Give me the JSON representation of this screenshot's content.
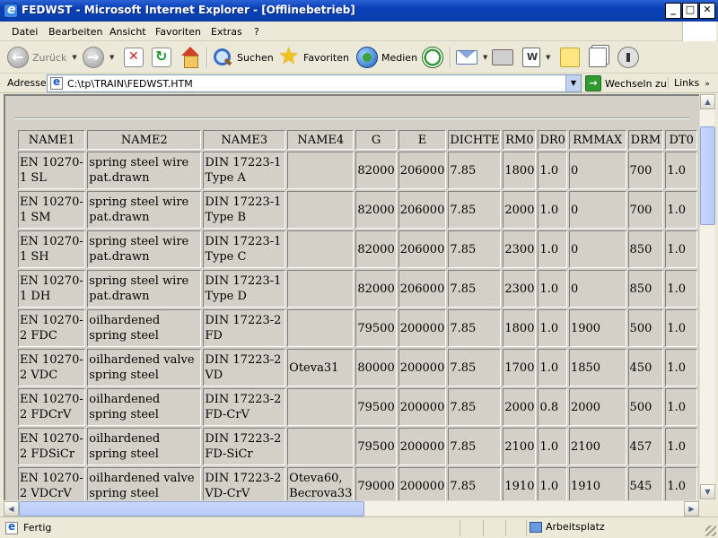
{
  "window": {
    "title": "FEDWST - Microsoft Internet Explorer - [Offlinebetrieb]"
  },
  "menu": [
    "Datei",
    "Bearbeiten",
    "Ansicht",
    "Favoriten",
    "Extras",
    "?"
  ],
  "toolbar": {
    "back_label": "Zurück",
    "search_label": "Suchen",
    "favorites_label": "Favoriten",
    "media_label": "Medien"
  },
  "address": {
    "label": "Adresse",
    "value": "C:\\tp\\TRAIN\\FEDWST.HTM",
    "go_label": "Wechseln zu",
    "links_label": "Links"
  },
  "table": {
    "headers": [
      "NAME1",
      "NAME2",
      "NAME3",
      "NAME4",
      "G",
      "E",
      "DICHTE",
      "RM0",
      "DR0",
      "RMMAX",
      "DRM",
      "DT0"
    ],
    "rows": [
      [
        "EN 10270-1 SL",
        "spring steel wire pat.drawn",
        "DIN 17223-1 Type A",
        "",
        "82000",
        "206000",
        "7.85",
        "1800",
        "1.0",
        "0",
        "700",
        "1.0"
      ],
      [
        "EN 10270-1 SM",
        "spring steel wire pat.drawn",
        "DIN 17223-1 Type B",
        "",
        "82000",
        "206000",
        "7.85",
        "2000",
        "1.0",
        "0",
        "700",
        "1.0"
      ],
      [
        "EN 10270-1 SH",
        "spring steel wire pat.drawn",
        "DIN 17223-1 Type C",
        "",
        "82000",
        "206000",
        "7.85",
        "2300",
        "1.0",
        "0",
        "850",
        "1.0"
      ],
      [
        "EN 10270-1 DH",
        "spring steel wire pat.drawn",
        "DIN 17223-1 Type D",
        "",
        "82000",
        "206000",
        "7.85",
        "2300",
        "1.0",
        "0",
        "850",
        "1.0"
      ],
      [
        "EN 10270-2 FDC",
        "oilhardened spring steel",
        "DIN 17223-2 FD",
        "",
        "79500",
        "200000",
        "7.85",
        "1800",
        "1.0",
        "1900",
        "500",
        "1.0"
      ],
      [
        "EN 10270-2 VDC",
        "oilhardened valve spring steel",
        "DIN 17223-2 VD",
        "Oteva31",
        "80000",
        "200000",
        "7.85",
        "1700",
        "1.0",
        "1850",
        "450",
        "1.0"
      ],
      [
        "EN 10270-2 FDCrV",
        "oilhardened spring steel",
        "DIN 17223-2 FD-CrV",
        "",
        "79500",
        "200000",
        "7.85",
        "2000",
        "0.8",
        "2000",
        "500",
        "1.0"
      ],
      [
        "EN 10270-2 FDSiCr",
        "oilhardened spring steel",
        "DIN 17223-2 FD-SiCr",
        "",
        "79500",
        "200000",
        "7.85",
        "2100",
        "1.0",
        "2100",
        "457",
        "1.0"
      ],
      [
        "EN 10270-2 VDCrV",
        "oilhardened valve spring steel",
        "DIN 17223-2 VD-CrV",
        "Oteva60, Becrova33",
        "79000",
        "200000",
        "7.85",
        "1910",
        "1.0",
        "1910",
        "545",
        "1.0"
      ]
    ]
  },
  "status": {
    "text": "Fertig",
    "zone": "Arbeitsplatz"
  }
}
